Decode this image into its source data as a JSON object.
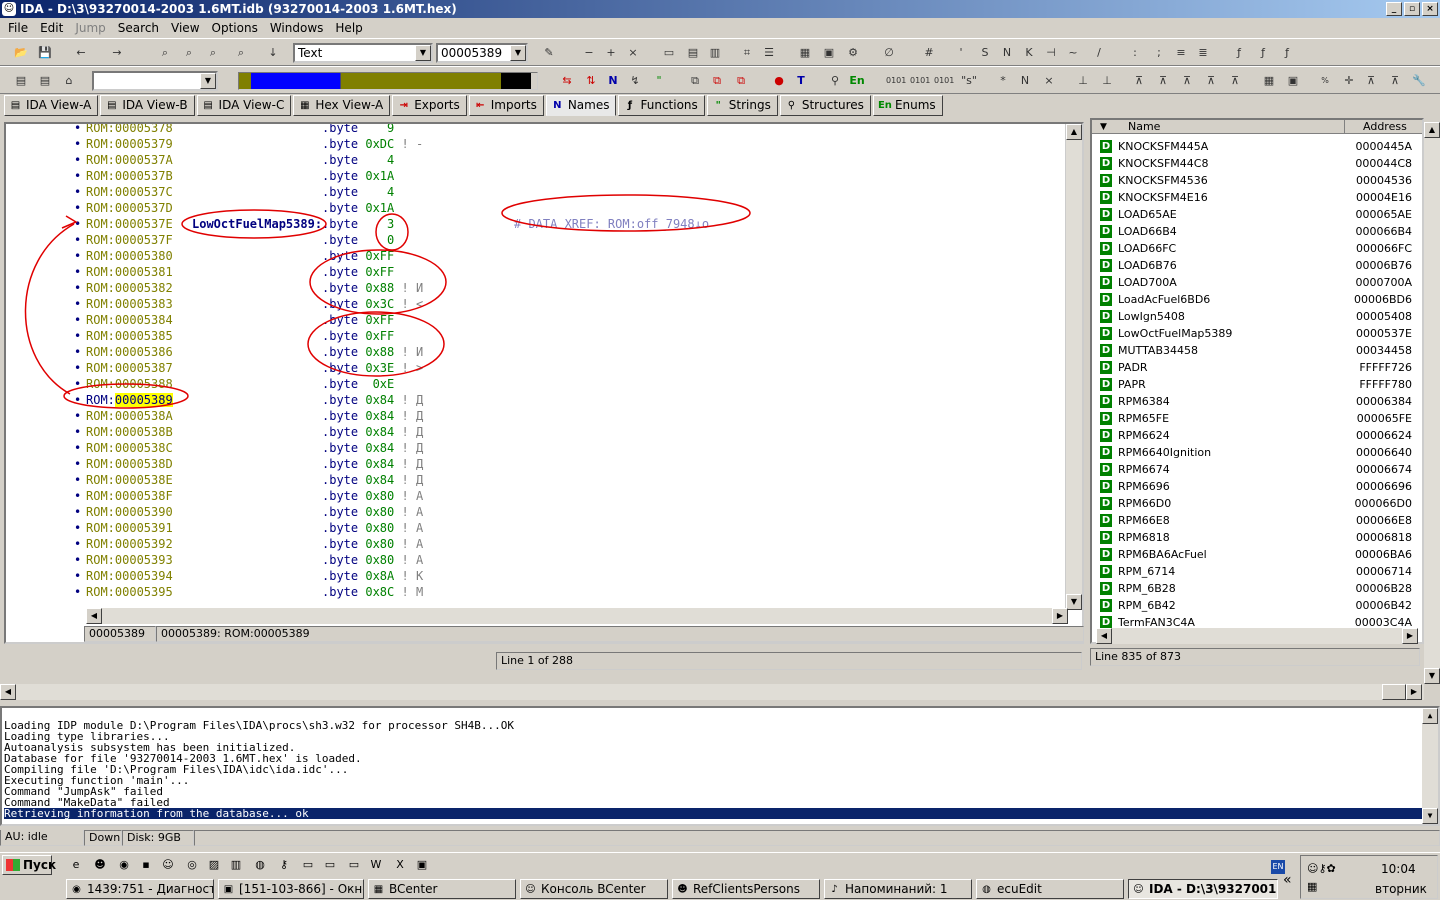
{
  "window": {
    "title": "IDA - D:\\3\\93270014-2003 1.6MT.idb (93270014-2003 1.6MT.hex)"
  },
  "menu": [
    "File",
    "Edit",
    "Jump",
    "Search",
    "View",
    "Options",
    "Windows",
    "Help"
  ],
  "toolbar": {
    "view_combo": "Text",
    "address_combo": "00005389"
  },
  "tabs": [
    {
      "label": "IDA View-A",
      "icon": "doc-icon"
    },
    {
      "label": "IDA View-B",
      "icon": "doc-icon"
    },
    {
      "label": "IDA View-C",
      "icon": "doc-icon"
    },
    {
      "label": "Hex View-A",
      "icon": "hex-icon"
    },
    {
      "label": "Exports",
      "icon": "exports-icon"
    },
    {
      "label": "Imports",
      "icon": "imports-icon"
    },
    {
      "label": "Names",
      "icon": "N",
      "active": true
    },
    {
      "label": "Functions",
      "icon": "functions-icon"
    },
    {
      "label": "Strings",
      "icon": "strings-icon"
    },
    {
      "label": "Structures",
      "icon": "structures-icon"
    },
    {
      "label": "Enums",
      "icon": "En"
    }
  ],
  "disasm": {
    "rows": [
      {
        "addr": "ROM:00005378",
        "instr": ".byte",
        "val": "   9",
        "cmt": ""
      },
      {
        "addr": "ROM:00005379",
        "instr": ".byte",
        "val": "0xDC",
        "cmt": "! -"
      },
      {
        "addr": "ROM:0000537A",
        "instr": ".byte",
        "val": "   4",
        "cmt": ""
      },
      {
        "addr": "ROM:0000537B",
        "instr": ".byte",
        "val": "0x1A",
        "cmt": ""
      },
      {
        "addr": "ROM:0000537C",
        "instr": ".byte",
        "val": "   4",
        "cmt": ""
      },
      {
        "addr": "ROM:0000537D",
        "instr": ".byte",
        "val": "0x1A",
        "cmt": ""
      },
      {
        "addr": "ROM:0000537E",
        "instr": ".byte",
        "val": "   3",
        "cmt": ""
      },
      {
        "addr": "ROM:0000537F",
        "instr": ".byte",
        "val": "   0",
        "cmt": ""
      },
      {
        "addr": "ROM:00005380",
        "instr": ".byte",
        "val": "0xFF",
        "cmt": ""
      },
      {
        "addr": "ROM:00005381",
        "instr": ".byte",
        "val": "0xFF",
        "cmt": ""
      },
      {
        "addr": "ROM:00005382",
        "instr": ".byte",
        "val": "0x88",
        "cmt": "! И"
      },
      {
        "addr": "ROM:00005383",
        "instr": ".byte",
        "val": "0x3C",
        "cmt": "! <"
      },
      {
        "addr": "ROM:00005384",
        "instr": ".byte",
        "val": "0xFF",
        "cmt": ""
      },
      {
        "addr": "ROM:00005385",
        "instr": ".byte",
        "val": "0xFF",
        "cmt": ""
      },
      {
        "addr": "ROM:00005386",
        "instr": ".byte",
        "val": "0x88",
        "cmt": "! И"
      },
      {
        "addr": "ROM:00005387",
        "instr": ".byte",
        "val": "0x3E",
        "cmt": "! >"
      },
      {
        "addr": "ROM:00005388",
        "instr": ".byte",
        "val": " 0xE",
        "cmt": ""
      },
      {
        "addr_prefix": "ROM:",
        "addr_hi": "00005389",
        "instr": ".byte",
        "val": "0x84",
        "cmt": "! Д"
      },
      {
        "addr": "ROM:0000538A",
        "instr": ".byte",
        "val": "0x84",
        "cmt": "! Д"
      },
      {
        "addr": "ROM:0000538B",
        "instr": ".byte",
        "val": "0x84",
        "cmt": "! Д"
      },
      {
        "addr": "ROM:0000538C",
        "instr": ".byte",
        "val": "0x84",
        "cmt": "! Д"
      },
      {
        "addr": "ROM:0000538D",
        "instr": ".byte",
        "val": "0x84",
        "cmt": "! Д"
      },
      {
        "addr": "ROM:0000538E",
        "instr": ".byte",
        "val": "0x84",
        "cmt": "! Д"
      },
      {
        "addr": "ROM:0000538F",
        "instr": ".byte",
        "val": "0x80",
        "cmt": "! А"
      },
      {
        "addr": "ROM:00005390",
        "instr": ".byte",
        "val": "0x80",
        "cmt": "! А"
      },
      {
        "addr": "ROM:00005391",
        "instr": ".byte",
        "val": "0x80",
        "cmt": "! А"
      },
      {
        "addr": "ROM:00005392",
        "instr": ".byte",
        "val": "0x80",
        "cmt": "! А"
      },
      {
        "addr": "ROM:00005393",
        "instr": ".byte",
        "val": "0x80",
        "cmt": "! А"
      },
      {
        "addr": "ROM:00005394",
        "instr": ".byte",
        "val": "0x8A",
        "cmt": "! К"
      },
      {
        "addr": "ROM:00005395",
        "instr": ".byte",
        "val": "0x8C",
        "cmt": "! М"
      }
    ],
    "label": "LowOctFuelMap5389:",
    "xref": "# DATA XREF: ROM:off_7948↓o",
    "status_left": "00005389",
    "status_right": "00005389: ROM:00005389",
    "line_info": "Line 1 of 288"
  },
  "names": {
    "col_name": "Name",
    "col_address": "Address",
    "rows": [
      {
        "name": "KNOCKSFM445A",
        "addr": "0000445A"
      },
      {
        "name": "KNOCKSFM44C8",
        "addr": "000044C8"
      },
      {
        "name": "KNOCKSFM4536",
        "addr": "00004536"
      },
      {
        "name": "KNOCKSFM4E16",
        "addr": "00004E16"
      },
      {
        "name": "LOAD65AE",
        "addr": "000065AE"
      },
      {
        "name": "LOAD66B4",
        "addr": "000066B4"
      },
      {
        "name": "LOAD66FC",
        "addr": "000066FC"
      },
      {
        "name": "LOAD6B76",
        "addr": "00006B76"
      },
      {
        "name": "LOAD700A",
        "addr": "0000700A"
      },
      {
        "name": "LoadAcFuel6BD6",
        "addr": "00006BD6"
      },
      {
        "name": "LowIgn5408",
        "addr": "00005408"
      },
      {
        "name": "LowOctFuelMap5389",
        "addr": "0000537E"
      },
      {
        "name": "MUTTAB34458",
        "addr": "00034458"
      },
      {
        "name": "PADR",
        "addr": "FFFFF726"
      },
      {
        "name": "PAPR",
        "addr": "FFFFF780"
      },
      {
        "name": "RPM6384",
        "addr": "00006384"
      },
      {
        "name": "RPM65FE",
        "addr": "000065FE"
      },
      {
        "name": "RPM6624",
        "addr": "00006624"
      },
      {
        "name": "RPM6640Ignition",
        "addr": "00006640"
      },
      {
        "name": "RPM6674",
        "addr": "00006674"
      },
      {
        "name": "RPM6696",
        "addr": "00006696"
      },
      {
        "name": "RPM66D0",
        "addr": "000066D0"
      },
      {
        "name": "RPM66E8",
        "addr": "000066E8"
      },
      {
        "name": "RPM6818",
        "addr": "00006818"
      },
      {
        "name": "RPM6BA6AcFuel",
        "addr": "00006BA6"
      },
      {
        "name": "RPM_6714",
        "addr": "00006714"
      },
      {
        "name": "RPM_6B28",
        "addr": "00006B28"
      },
      {
        "name": "RPM_6B42",
        "addr": "00006B42"
      },
      {
        "name": "TermFAN3C4A",
        "addr": "00003C4A"
      }
    ],
    "line_info": "Line 835 of 873"
  },
  "output": {
    "lines": [
      "Loading IDP module D:\\Program Files\\IDA\\procs\\sh3.w32 for processor SH4B...OK",
      "Loading type libraries...",
      "Autoanalysis subsystem has been initialized.",
      "Database for file '93270014-2003 1.6MT.hex' is loaded.",
      "Compiling file 'D:\\Program Files\\IDA\\idc\\ida.idc'...",
      "Executing function 'main'...",
      "Command \"JumpAsk\" failed",
      "Command \"MakeData\" failed",
      "Retrieving information from the database... ok"
    ]
  },
  "status": {
    "au": "AU:  idle",
    "dir": "Down",
    "disk": "Disk: 9GB"
  },
  "taskbar": {
    "start": "Пуск",
    "items": [
      {
        "label": "1439:751 - Диагност..."
      },
      {
        "label": "[151-103-866] - Окно ..."
      },
      {
        "label": "BCenter"
      },
      {
        "label": "Консоль BCenter"
      },
      {
        "label": "RefClientsPersons"
      },
      {
        "label": "Напоминаний: 1"
      },
      {
        "label": "ecuEdit"
      },
      {
        "label": "IDA - D:\\3\\9327001..."
      }
    ],
    "lang": "EN",
    "clock": "10:04",
    "day": "вторник"
  }
}
